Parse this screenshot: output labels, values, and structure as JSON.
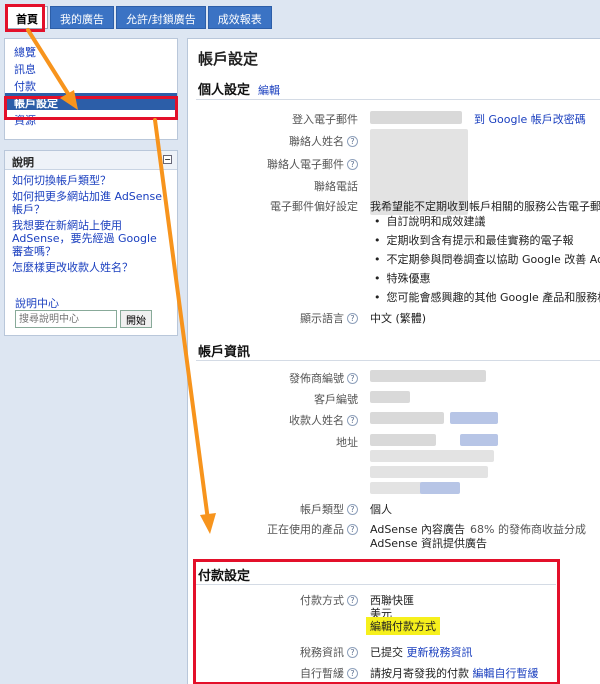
{
  "tabs": [
    {
      "label": "首頁",
      "active": true
    },
    {
      "label": "我的廣告",
      "active": false
    },
    {
      "label": "允許/封鎖廣告",
      "active": false
    },
    {
      "label": "成效報表",
      "active": false
    }
  ],
  "sidebar": {
    "items": [
      {
        "label": "總覽"
      },
      {
        "label": "訊息"
      },
      {
        "label": "付款"
      },
      {
        "label": "帳戶設定",
        "selected": true
      },
      {
        "label": "資源"
      }
    ]
  },
  "help": {
    "title": "說明",
    "collapse_symbol": "−",
    "links": [
      "如何切換帳戶類型？",
      "如何把更多網站加進 AdSense 帳戶？",
      "我想要在新網站上使用 AdSense，要先經過 Google 審查嗎？",
      "怎麼樣更改收款人姓名？"
    ],
    "center_label": "說明中心",
    "search_placeholder": "搜尋說明中心",
    "search_button": "開始"
  },
  "main": {
    "title": "帳戶設定",
    "personal": {
      "heading": "個人設定",
      "edit": "編輯",
      "login_email_label": "登入電子郵件",
      "change_pwd_link": "到 Google 帳戶改密碼",
      "contact_name_label": "聯絡人姓名",
      "contact_email_label": "聯絡人電子郵件",
      "contact_phone_label": "聯絡電話",
      "email_pref_label": "電子郵件偏好設定",
      "email_pref_intro": "我希望能不定期收到帳戶相關的服務公告電子郵件",
      "email_pref_items": [
        "自訂說明和成效建議",
        "定期收到含有提示和最佳實務的電子報",
        "不定期參與問卷調查以協助 Google 改善 AdSe",
        "特殊優惠",
        "您可能會感興趣的其他 Google 產品和服務相關"
      ],
      "display_lang_label": "顯示語言",
      "display_lang_value": "中文 (繁體)"
    },
    "account": {
      "heading": "帳戶資訊",
      "publisher_id_label": "發佈商編號",
      "customer_id_label": "客戶編號",
      "payee_name_label": "收款人姓名",
      "address_label": "地址",
      "account_type_label": "帳戶類型",
      "account_type_value": "個人",
      "products_label": "正在使用的產品",
      "product_1": "AdSense 內容廣告",
      "product_1_share": "68% 的發佈商收益分成",
      "product_2": "AdSense 資訊提供廣告"
    },
    "payment": {
      "heading": "付款設定",
      "method_label": "付款方式",
      "method_value": "西聯快匯",
      "currency": "美元",
      "edit_method": "編輯付款方式",
      "tax_label": "稅務資訊",
      "tax_value": "已提交",
      "tax_update": "更新稅務資訊",
      "hold_label": "自行暫緩",
      "hold_value": "請按月寄發我的付款",
      "hold_edit": "編輯自行暫緩"
    }
  },
  "colors": {
    "highlight": "#e3102a",
    "arrow": "#f7941d",
    "tab_blue": "#3b73c4"
  }
}
